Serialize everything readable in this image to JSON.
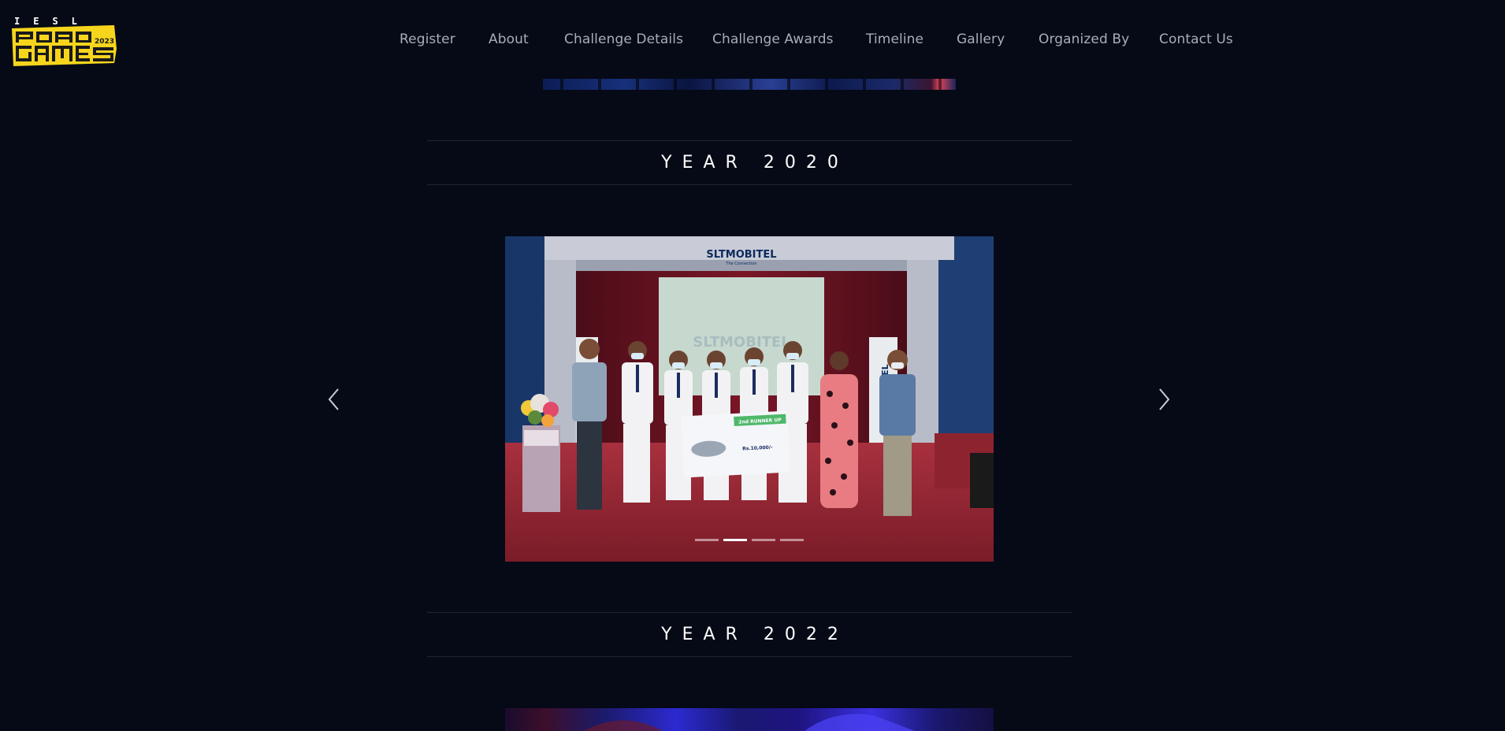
{
  "logo": {
    "top_text": "IESL",
    "main_text": "ROBOGAMES",
    "year_text": "2023",
    "colors": {
      "background": "#f7d51d",
      "ink": "#1a1a1a"
    }
  },
  "nav": {
    "items": [
      {
        "label": "Register"
      },
      {
        "label": "About"
      },
      {
        "label": "Challenge Details"
      },
      {
        "label": "Challenge Awards"
      },
      {
        "label": "Timeline"
      },
      {
        "label": "Gallery"
      },
      {
        "label": "Organized By"
      },
      {
        "label": "Contact Us"
      }
    ]
  },
  "sections": {
    "year_2020": {
      "title": "YEAR 2020"
    },
    "year_2022": {
      "title": "YEAR 2022"
    }
  },
  "carousel": {
    "photo": {
      "backdrop_logo": "SLTMOBITEL",
      "backdrop_tagline": "The Connection",
      "banner_text": "SLTMOBITEL",
      "cheque_title": "2nd RUNNER UP",
      "cheque_amount": "Rs.10,000/-"
    },
    "indicator_count": 4,
    "active_index": 1,
    "prev_icon": "chevron-left-icon",
    "next_icon": "chevron-right-icon"
  },
  "colors": {
    "page_background": "#050a16",
    "nav_text": "#a9adb7",
    "heading_text": "#ffffff",
    "divider": "#1f2533"
  }
}
